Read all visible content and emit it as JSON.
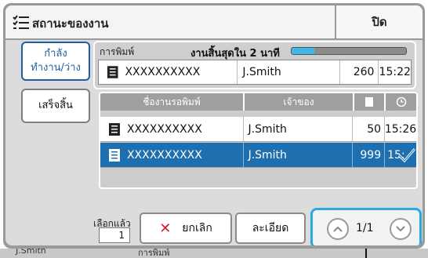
{
  "title": "สถานะของงาน",
  "close_label": "ปิด",
  "tabs": [
    {
      "line1": "กำลัง",
      "line2": "ทำงาน/ว่าง"
    },
    {
      "line1": "เสร็จสิ้น",
      "line2": ""
    }
  ],
  "printing": {
    "label": "การพิมพ์",
    "remaining": "งานสิ้นสุดใน 2 นาที",
    "progress": 0.2,
    "job": {
      "name": "XXXXXXXXXX",
      "owner": "J.Smith",
      "pages": "260",
      "time": "15:22"
    }
  },
  "waiting": {
    "columns": [
      "ชื่องานรอพิมพ์",
      "เจ้าของ"
    ],
    "rows": [
      {
        "name": "XXXXXXXXXX",
        "owner": "J.Smith",
        "pages": "50",
        "time": "15:26",
        "selected": false
      },
      {
        "name": "XXXXXXXXXX",
        "owner": "J.Smith",
        "pages": "999",
        "time": "15:",
        "selected": true
      }
    ]
  },
  "bottom": {
    "selected_label": "เลือกแล้ว",
    "selected_count": "1",
    "cancel_label": "ยกเลิก",
    "detail_label": "ละเอียด",
    "page": "1/1"
  },
  "underlay": {
    "left_text": "J.Smith",
    "mid_text": "การพิมพ์"
  },
  "colors": {
    "accent": "#2aa9df",
    "selected_row": "#1e6fb0",
    "cancel": "#d62020"
  }
}
